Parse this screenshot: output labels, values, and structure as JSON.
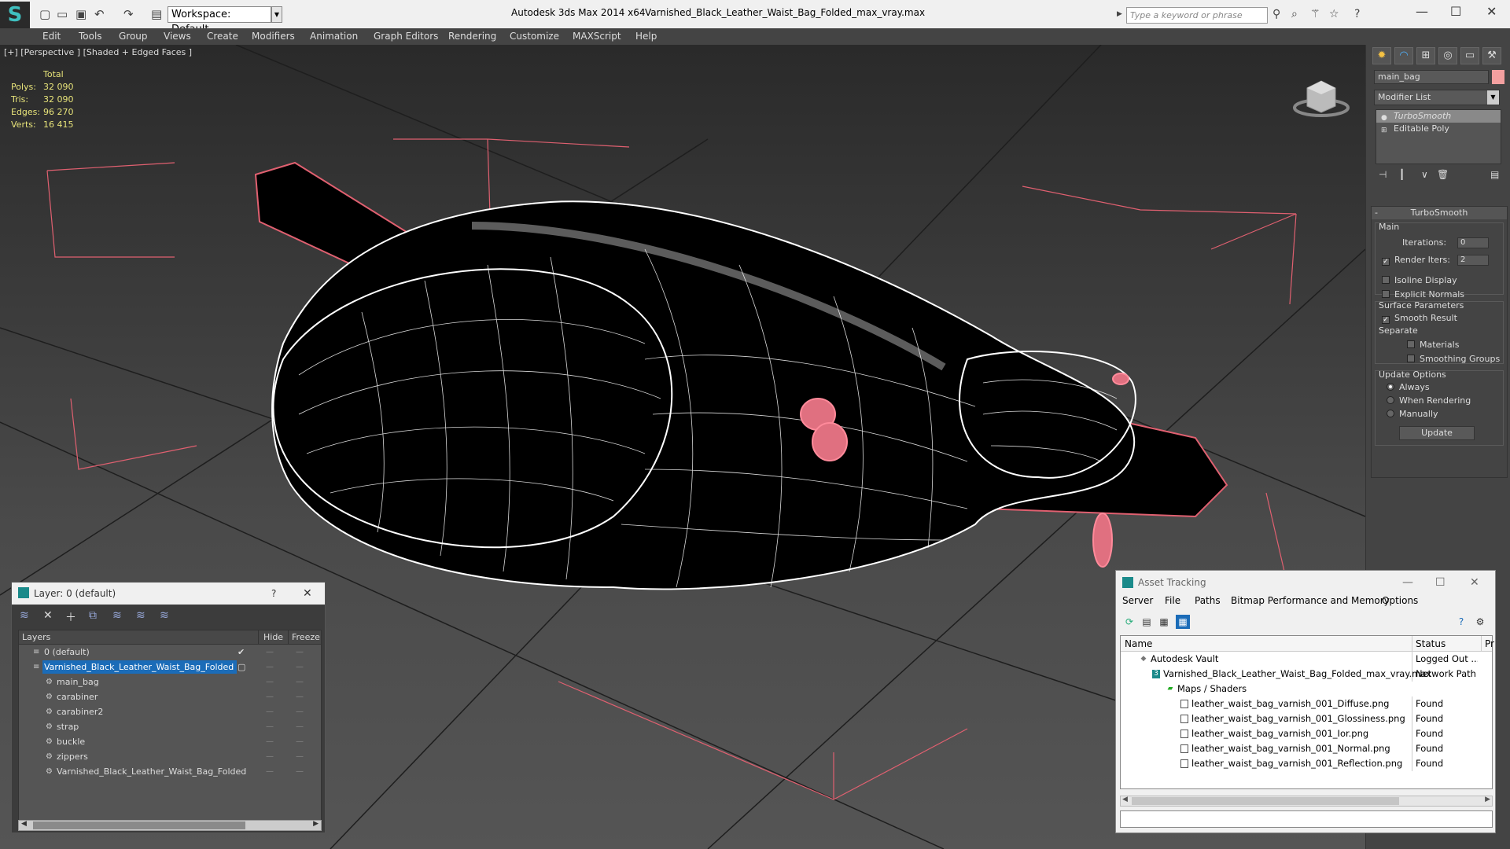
{
  "titlebar": {
    "workspace": "Workspace: Default",
    "app_title": "Autodesk 3ds Max  2014 x64",
    "document_title": "Varnished_Black_Leather_Waist_Bag_Folded_max_vray.max",
    "search_placeholder": "Type a keyword or phrase"
  },
  "menu": [
    "Edit",
    "Tools",
    "Group",
    "Views",
    "Create",
    "Modifiers",
    "Animation",
    "Graph Editors",
    "Rendering",
    "Customize",
    "MAXScript",
    "Help"
  ],
  "viewport": {
    "label": "[+] [Perspective ] [Shaded + Edged Faces ]",
    "stats": {
      "header": "Total",
      "rows": [
        {
          "k": "Polys:",
          "v": "32 090"
        },
        {
          "k": "Tris:",
          "v": "32 090"
        },
        {
          "k": "Edges:",
          "v": "96 270"
        },
        {
          "k": "Verts:",
          "v": "16 415"
        }
      ]
    }
  },
  "command_panel": {
    "object_name": "main_bag",
    "object_color": "#f4a0a0",
    "modifier_list": "Modifier List",
    "stack": [
      "TurboSmooth",
      "Editable Poly"
    ],
    "rollout_title": "TurboSmooth",
    "main_group": "Main",
    "iterations_label": "Iterations:",
    "iterations_value": "0",
    "render_iters_label": "Render Iters:",
    "render_iters_value": "2",
    "isoline": "Isoline Display",
    "explicit_normals": "Explicit Normals",
    "surface_group": "Surface Parameters",
    "smooth_result": "Smooth Result",
    "separate": "Separate",
    "materials": "Materials",
    "smoothing_groups": "Smoothing Groups",
    "update_group": "Update Options",
    "always": "Always",
    "when_rendering": "When Rendering",
    "manually": "Manually",
    "update_btn": "Update"
  },
  "layer_window": {
    "title": "Layer: 0 (default)",
    "help": "?",
    "col_layers": "Layers",
    "col_hide": "Hide",
    "col_freeze": "Freeze",
    "rows": [
      {
        "name": "0 (default)"
      },
      {
        "name": "Varnished_Black_Leather_Waist_Bag_Folded"
      },
      {
        "name": "main_bag"
      },
      {
        "name": "carabiner"
      },
      {
        "name": "carabiner2"
      },
      {
        "name": "strap"
      },
      {
        "name": "buckle"
      },
      {
        "name": "zippers"
      },
      {
        "name": "Varnished_Black_Leather_Waist_Bag_Folded"
      }
    ]
  },
  "asset_window": {
    "title": "Asset Tracking",
    "menu": [
      "Server",
      "File",
      "Paths",
      "Bitmap Performance and Memory",
      "Options"
    ],
    "col_name": "Name",
    "col_status": "Status",
    "col_extra": "Pr",
    "rows": [
      {
        "name": "Autodesk Vault",
        "status": "Logged Out ..."
      },
      {
        "name": "Varnished_Black_Leather_Waist_Bag_Folded_max_vray.max",
        "status": "Network Path"
      },
      {
        "name": "Maps / Shaders",
        "status": ""
      },
      {
        "name": "leather_waist_bag_varnish_001_Diffuse.png",
        "status": "Found"
      },
      {
        "name": "leather_waist_bag_varnish_001_Glossiness.png",
        "status": "Found"
      },
      {
        "name": "leather_waist_bag_varnish_001_Ior.png",
        "status": "Found"
      },
      {
        "name": "leather_waist_bag_varnish_001_Normal.png",
        "status": "Found"
      },
      {
        "name": "leather_waist_bag_varnish_001_Reflection.png",
        "status": "Found"
      }
    ]
  }
}
